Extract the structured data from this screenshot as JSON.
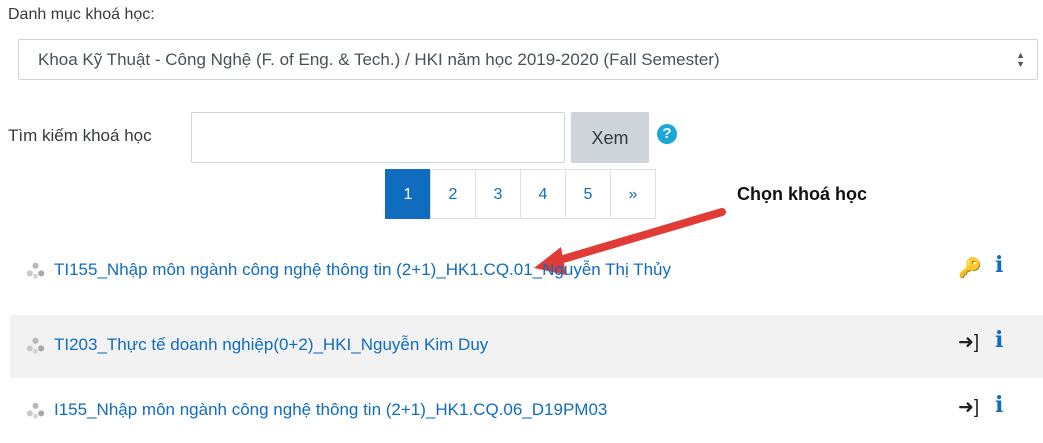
{
  "category": {
    "label": "Danh mục khoá học:",
    "selected": "Khoa Kỹ Thuật - Công Nghệ (F. of Eng. & Tech.) / HKI năm học 2019-2020 (Fall Semester)"
  },
  "search": {
    "label": "Tìm kiếm khoá học",
    "value": "",
    "button_label": "Xem"
  },
  "help": {
    "icon": "question-circle-icon",
    "glyph": "?"
  },
  "pagination": {
    "pages": [
      "1",
      "2",
      "3",
      "4",
      "5"
    ],
    "next": "»",
    "active": "1"
  },
  "annotation": {
    "text": "Chọn khoá học",
    "arrow_color": "#e03b35"
  },
  "courses": [
    {
      "title": "TI155_Nhập môn ngành công nghệ thông tin (2+1)_HK1.CQ.01_Nguyễn Thị Thủy",
      "enrol_icon": "key-icon",
      "enrol_glyph": "🔑"
    },
    {
      "title": "TI203_Thực tế doanh nghiệp(0+2)_HKI_Nguyễn Kim Duy",
      "enrol_icon": "sign-in-icon",
      "enrol_glyph": "➜]"
    },
    {
      "title": "I155_Nhập môn ngành công nghệ thông tin (2+1)_HK1.CQ.06_D19PM03",
      "enrol_icon": "sign-in-icon",
      "enrol_glyph": "➜]"
    }
  ],
  "info_glyph": "i",
  "colors": {
    "link": "#0f6cbf",
    "accent": "#0f6cbf",
    "help": "#1ba7d8"
  }
}
